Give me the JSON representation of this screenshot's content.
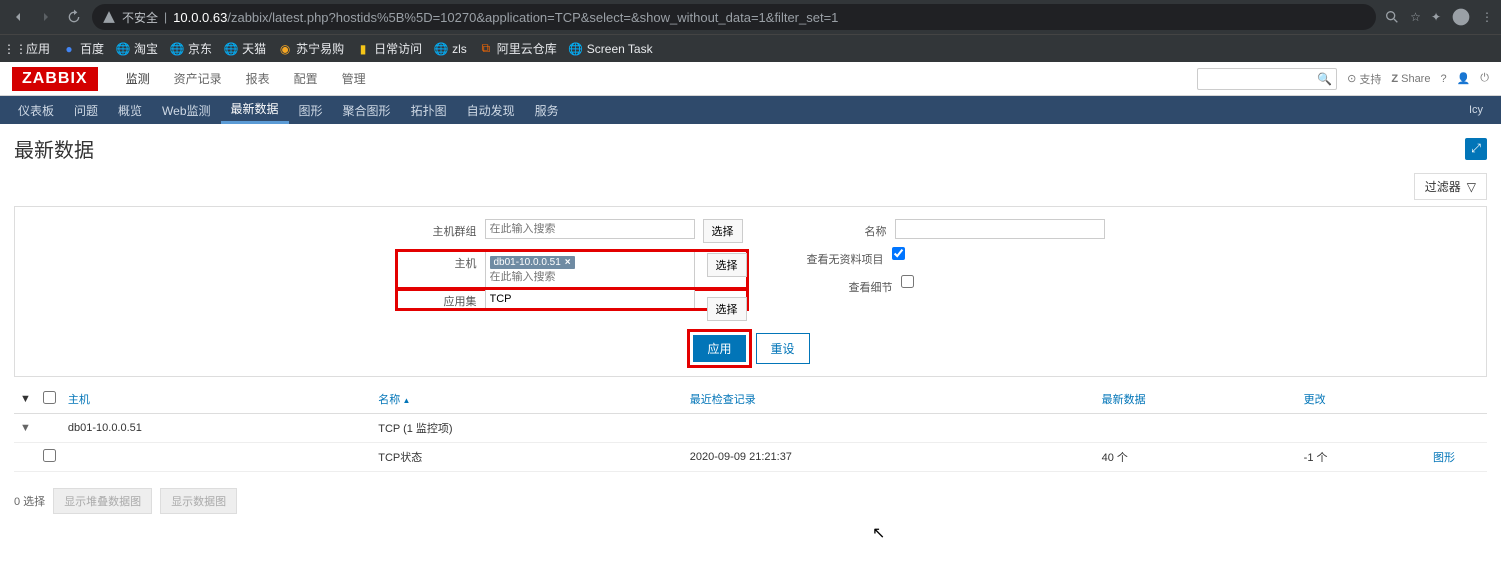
{
  "browser": {
    "insecure_label": "不安全",
    "url_host": "10.0.0.63",
    "url_path": "/zabbix/latest.php?hostids%5B%5D=10270&application=TCP&select=&show_without_data=1&filter_set=1"
  },
  "bookmarks": [
    {
      "icon": "⋮⋮",
      "label": "应用"
    },
    {
      "icon": "🔵",
      "label": "百度"
    },
    {
      "icon": "🌐",
      "label": "淘宝"
    },
    {
      "icon": "🌐",
      "label": "京东"
    },
    {
      "icon": "🌐",
      "label": "天猫"
    },
    {
      "icon": "🔴",
      "label": "苏宁易购"
    },
    {
      "icon": "📁",
      "label": "日常访问"
    },
    {
      "icon": "🌐",
      "label": "zls"
    },
    {
      "icon": "⧉",
      "label": "阿里云仓库"
    },
    {
      "icon": "🌐",
      "label": "Screen Task"
    }
  ],
  "zabbix": {
    "logo": "ZABBIX",
    "mainnav": [
      "监测",
      "资产记录",
      "报表",
      "配置",
      "管理"
    ],
    "mainnav_active": 0,
    "support": "支持",
    "share": "Share",
    "subnav": [
      "仪表板",
      "问题",
      "概览",
      "Web监测",
      "最新数据",
      "图形",
      "聚合图形",
      "拓扑图",
      "自动发现",
      "服务"
    ],
    "subnav_active": 4,
    "username": "Icy"
  },
  "page": {
    "title": "最新数据",
    "filter_label": "过滤器"
  },
  "filter": {
    "labels": {
      "hostgroup": "主机群组",
      "host": "主机",
      "app": "应用集",
      "name": "名称",
      "show_no_data": "查看无资料项目",
      "show_details": "查看细节"
    },
    "placeholder": "在此输入搜索",
    "select_btn": "选择",
    "host_tag": "db01-10.0.0.51",
    "app_value": "TCP",
    "name_value": "",
    "show_no_data_checked": true,
    "show_details_checked": false,
    "apply_btn": "应用",
    "reset_btn": "重设"
  },
  "table": {
    "headers": {
      "host": "主机",
      "name": "名称",
      "last_check": "最近检查记录",
      "last_value": "最新数据",
      "change": "更改"
    },
    "group_row": {
      "host": "db01-10.0.0.51",
      "app": "TCP (1 监控项)"
    },
    "item_row": {
      "name": "TCP状态",
      "last_check": "2020-09-09 21:21:37",
      "last_value": "40 个",
      "change": "-1 个",
      "link": "图形"
    }
  },
  "footer": {
    "selected": "0 选择",
    "btn1": "显示堆叠数据图",
    "btn2": "显示数据图"
  }
}
